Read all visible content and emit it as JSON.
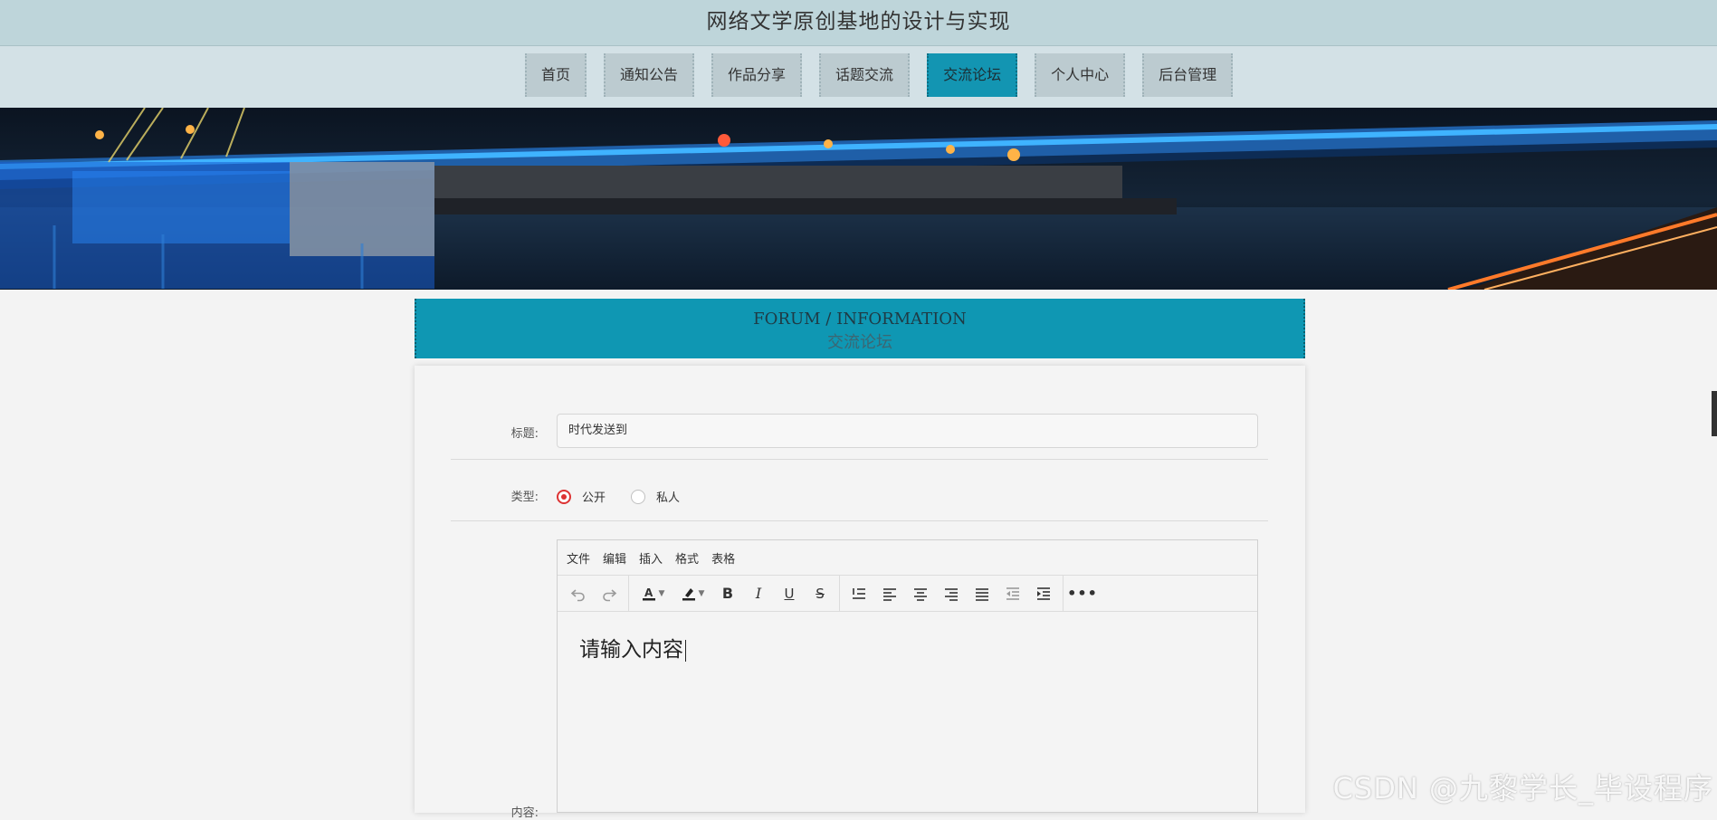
{
  "site": {
    "title": "网络文学原创基地的设计与实现"
  },
  "nav": {
    "items": [
      {
        "label": "首页"
      },
      {
        "label": "通知公告"
      },
      {
        "label": "作品分享"
      },
      {
        "label": "话题交流"
      },
      {
        "label": "交流论坛",
        "active": true
      },
      {
        "label": "个人中心"
      },
      {
        "label": "后台管理"
      }
    ]
  },
  "section": {
    "title_en": "FORUM / INFORMATION",
    "title_cn": "交流论坛"
  },
  "form": {
    "title_label": "标题:",
    "title_value": "时代发送到",
    "type_label": "类型:",
    "type_options": [
      {
        "label": "公开",
        "checked": true
      },
      {
        "label": "私人",
        "checked": false
      }
    ],
    "content_label": "内容:"
  },
  "editor": {
    "menus": [
      "文件",
      "编辑",
      "插入",
      "格式",
      "表格"
    ],
    "toolbar_icons": [
      "undo-icon",
      "redo-icon",
      "text-color-icon",
      "highlight-icon",
      "bold-icon",
      "italic-icon",
      "underline-icon",
      "strikethrough-icon",
      "line-height-icon",
      "align-left-icon",
      "align-center-icon",
      "align-right-icon",
      "align-justify-icon",
      "outdent-icon",
      "indent-icon",
      "more-icon"
    ],
    "placeholder": "请输入内容"
  },
  "watermark": "CSDN @九黎学长_毕设程序",
  "colors": {
    "accent": "#1395b2",
    "topbar": "#bed5da",
    "navbar": "#d3e1e6",
    "radio_checked": "#dd3333"
  }
}
